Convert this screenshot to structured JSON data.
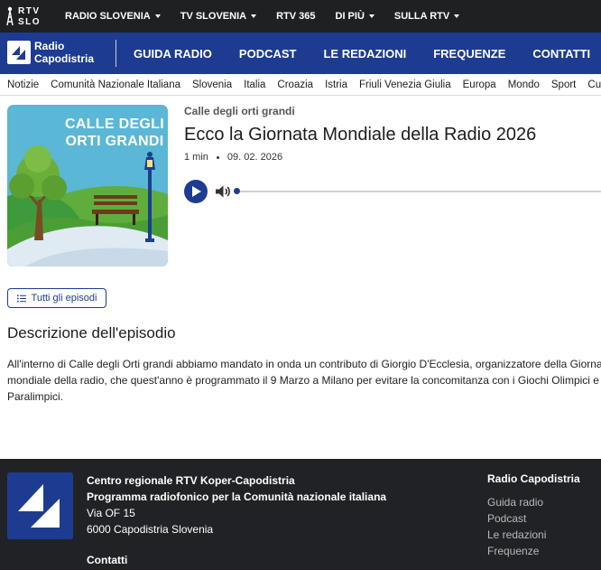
{
  "topbar": {
    "logo": {
      "line1": "RTV",
      "line2": "SLO"
    },
    "items": [
      {
        "label": "RADIO SLOVENIA",
        "dropdown": true
      },
      {
        "label": "TV SLOVENIA",
        "dropdown": true
      },
      {
        "label": "RTV 365",
        "dropdown": false
      },
      {
        "label": "DI PIÙ",
        "dropdown": true
      },
      {
        "label": "SULLA RTV",
        "dropdown": true
      }
    ]
  },
  "brand": {
    "line1": "Radio",
    "line2": "Capodistria"
  },
  "main_nav": [
    {
      "label": "GUIDA RADIO"
    },
    {
      "label": "PODCAST"
    },
    {
      "label": "LE REDAZIONI"
    },
    {
      "label": "FREQUENZE"
    },
    {
      "label": "CONTATTI"
    }
  ],
  "categories": [
    "Notizie",
    "Comunità Nazionale Italiana",
    "Slovenia",
    "Italia",
    "Croazia",
    "Istria",
    "Friuli Venezia Giulia",
    "Europa",
    "Mondo",
    "Sport",
    "Cultura"
  ],
  "cover": {
    "title": "CALLE DEGLI ORTI GRANDI"
  },
  "episode": {
    "show": "Calle degli orti grandi",
    "title": "Ecco la Giornata Mondiale della Radio 2026",
    "duration": "1 min",
    "date": "09. 02. 2026",
    "progress": 0.0
  },
  "all_episodes_label": "Tutti gli episodi",
  "description": {
    "heading": "Descrizione dell'episodio",
    "text": "All'interno di Calle degli Orti grandi abbiamo mandato in onda un contributo di Giorgio D'Ecclesia, organizzatore della Giornata mondiale della radio, che quest'anno è programmato il 9 Marzo a Milano per evitare la concomitanza con i Giochi Olimpici e Paralimpici."
  },
  "footer": {
    "org_line1": "Centro regionale RTV Koper-Capodistria",
    "org_line2": "Programma radiofonico per la Comunità nazionale italiana",
    "street": "Via OF 15",
    "city": "6000 Capodistria Slovenia",
    "contatti": "Contatti",
    "column_title": "Radio Capodistria",
    "links": [
      "Guida radio",
      "Podcast",
      "Le redazioni",
      "Frequenze"
    ]
  },
  "colors": {
    "brand_blue": "#1d3c91",
    "topbar": "#1f2022",
    "footer": "#212226"
  }
}
